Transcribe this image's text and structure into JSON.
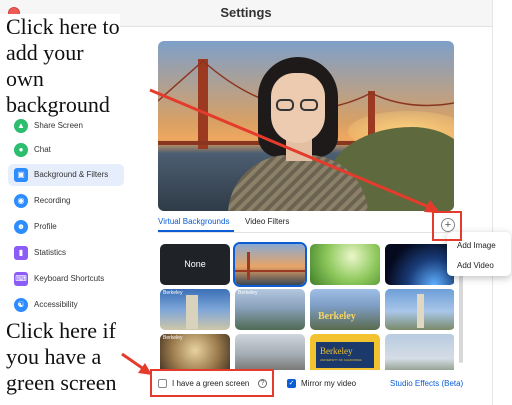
{
  "window": {
    "title": "Settings"
  },
  "sidebar": {
    "items": [
      {
        "label": "Share Screen",
        "icon": "share-screen-icon",
        "color": "#2dbd6e"
      },
      {
        "label": "Chat",
        "icon": "chat-icon",
        "color": "#2dbd6e"
      },
      {
        "label": "Background & Filters",
        "icon": "background-icon",
        "color": "#2d8cff",
        "active": true
      },
      {
        "label": "Recording",
        "icon": "recording-icon",
        "color": "#2d8cff"
      },
      {
        "label": "Profile",
        "icon": "profile-icon",
        "color": "#2d8cff"
      },
      {
        "label": "Statistics",
        "icon": "statistics-icon",
        "color": "#8b5cf6"
      },
      {
        "label": "Keyboard Shortcuts",
        "icon": "keyboard-icon",
        "color": "#8b5cf6"
      },
      {
        "label": "Accessibility",
        "icon": "accessibility-icon",
        "color": "#2d8cff"
      }
    ]
  },
  "tabs": [
    {
      "label": "Virtual Backgrounds",
      "active": true
    },
    {
      "label": "Video Filters",
      "active": false
    }
  ],
  "add_button": {
    "symbol": "+"
  },
  "dropdown": {
    "items": [
      "Add Image",
      "Add Video"
    ]
  },
  "backgrounds": [
    {
      "label": "None"
    },
    {
      "label": "Golden Gate Bridge"
    },
    {
      "label": "Grass"
    },
    {
      "label": "Earth from space"
    },
    {
      "label": "Berkeley campus 1"
    },
    {
      "label": "Berkeley campus 2"
    },
    {
      "label": "Berkeley campus 3"
    },
    {
      "label": "Berkeley campus 4"
    },
    {
      "label": "Berkeley campus 5"
    },
    {
      "label": "Berkeley campus 6"
    },
    {
      "label": "Berkeley campus 7"
    },
    {
      "label": "Berkeley campus 8"
    }
  ],
  "thumb_text": {
    "none": "None",
    "berkeley": "Berkeley",
    "berkeley_small": "Berkeley",
    "university": "UNIVERSITY OF CALIFORNIA"
  },
  "options": {
    "green_screen": {
      "label": "I have a green screen",
      "checked": false
    },
    "mirror_video": {
      "label": "Mirror my video",
      "checked": true
    },
    "studio_effects": {
      "label": "Studio Effects (Beta)"
    }
  },
  "annotations": {
    "top": [
      "Click here to",
      "add your",
      "own",
      "background"
    ],
    "bottom": [
      "Click here if",
      "you have a",
      "green screen"
    ]
  },
  "colors": {
    "accent": "#0b5cd5",
    "annotation_red": "#e43b2c"
  }
}
